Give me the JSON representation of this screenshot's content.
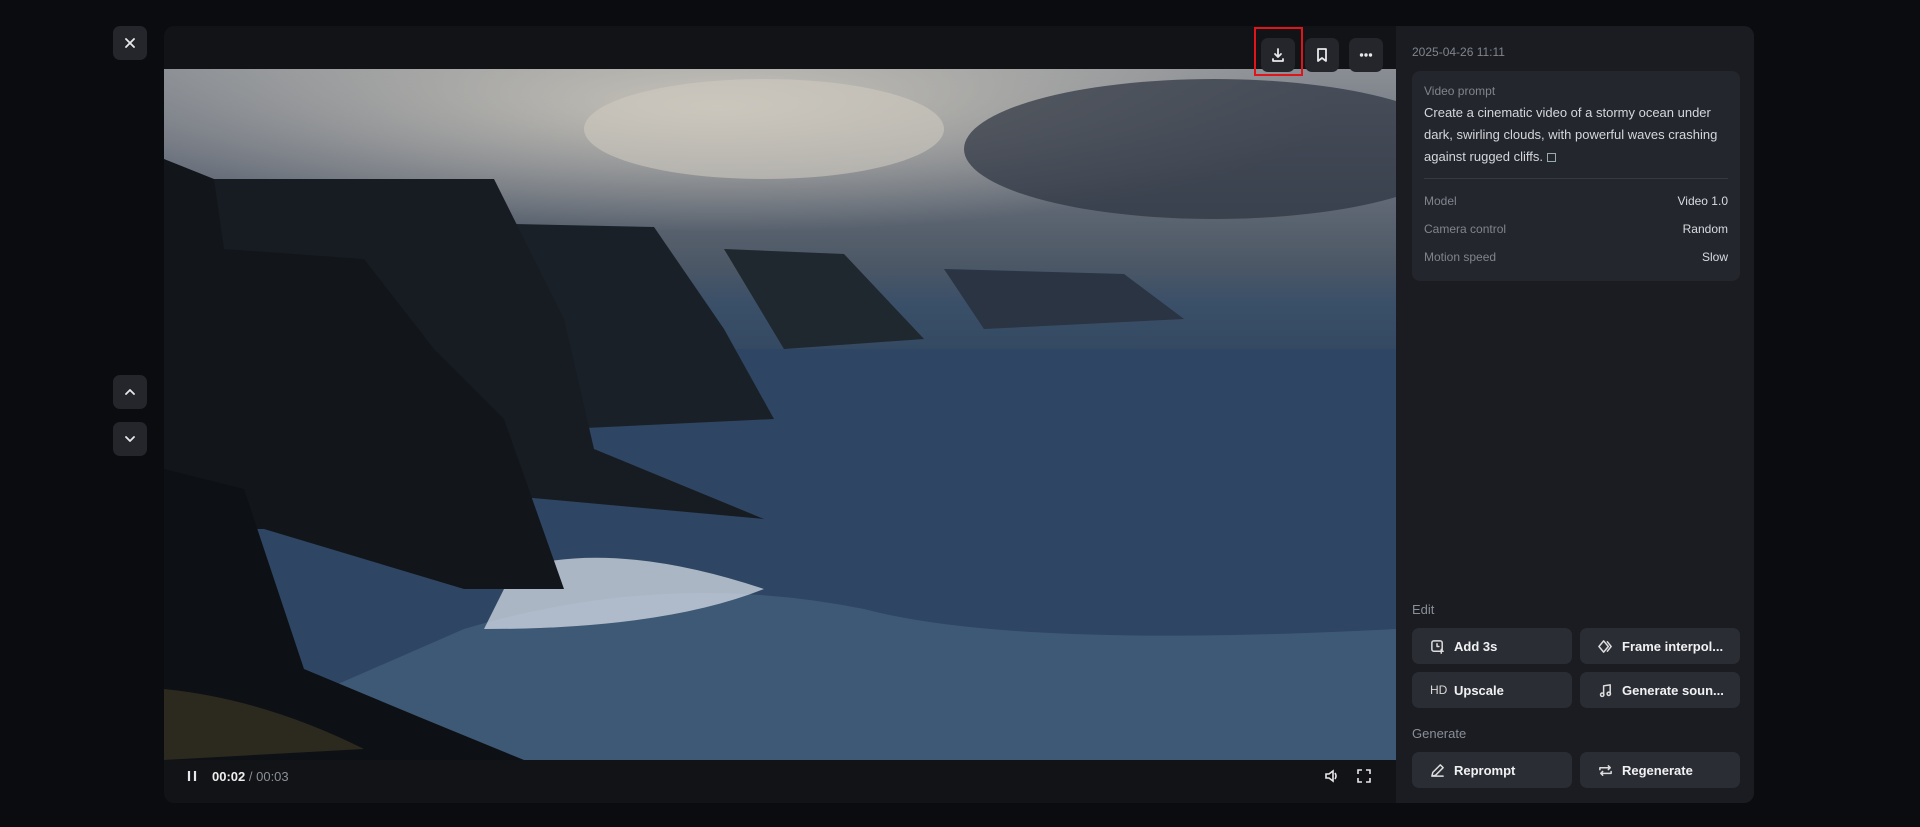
{
  "player": {
    "current_time": "00:02",
    "duration": "00:03",
    "progress_fraction": 0.79
  },
  "toolbar": {
    "icons": [
      "download-icon",
      "bookmark-icon",
      "more-icon"
    ]
  },
  "panel": {
    "date": "2025-04-26 11:11",
    "prompt_label": "Video prompt",
    "prompt_text": "Create a cinematic video of a stormy ocean under dark, swirling clouds, with powerful waves crashing against rugged cliffs.",
    "details": [
      {
        "label": "Model",
        "value": "Video 1.0"
      },
      {
        "label": "Camera control",
        "value": "Random"
      },
      {
        "label": "Motion speed",
        "value": "Slow"
      }
    ],
    "edit_label": "Edit",
    "generate_label": "Generate",
    "edit_buttons": [
      {
        "label": "Add 3s"
      },
      {
        "label": "Frame interpol..."
      },
      {
        "label": "Upscale",
        "icon_text": "HD"
      },
      {
        "label": "Generate soun..."
      }
    ],
    "generate_buttons": [
      {
        "label": "Reprompt"
      },
      {
        "label": "Regenerate"
      }
    ]
  },
  "colors": {
    "highlight": "#e0141b",
    "panel": "#1a1c21",
    "button": "#2b2d34"
  }
}
